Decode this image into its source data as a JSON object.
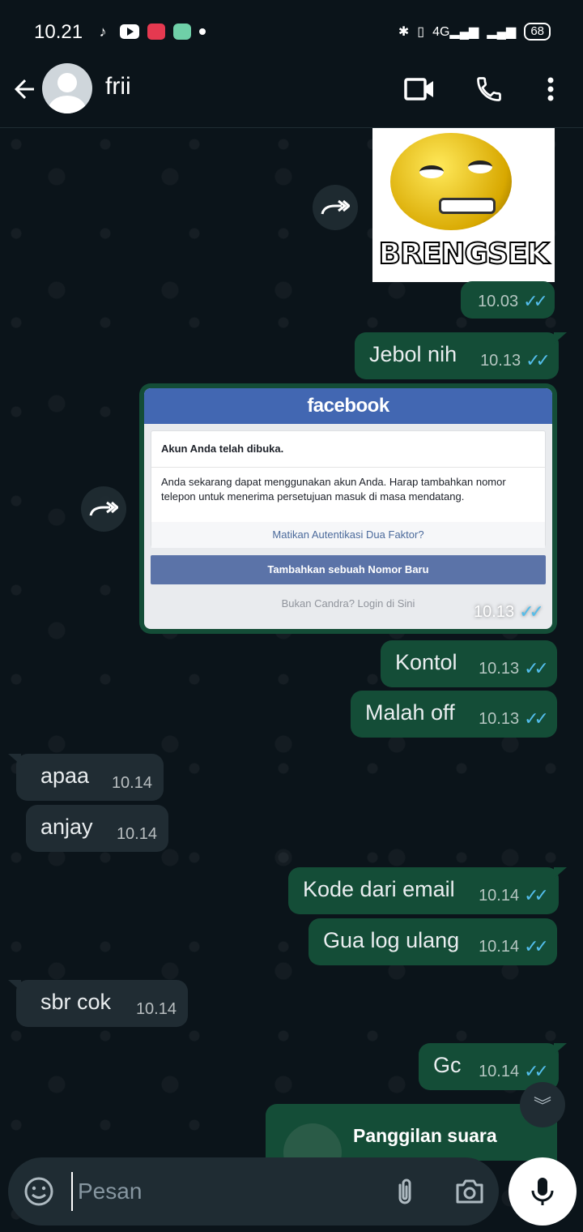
{
  "status_bar": {
    "time": "10.21",
    "signal_label": "4G",
    "battery": "68"
  },
  "header": {
    "contact_name": "frii",
    "icons": [
      "back-arrow-icon",
      "avatar",
      "video-call-icon",
      "phone-icon",
      "more-vert-icon"
    ]
  },
  "sticker": {
    "text": "BRENGSEK",
    "time": "10.03"
  },
  "messages_a": [
    {
      "text": "Jebol nih",
      "time": "10.13",
      "dir": "out"
    }
  ],
  "screenshot_card": {
    "brand": "facebook",
    "title": "Akun Anda telah dibuka.",
    "body": "Anda sekarang dapat menggunakan akun Anda. Harap tambahkan nomor telepon untuk menerima persetujuan masuk di masa mendatang.",
    "link": "Matikan Autentikasi Dua Faktor?",
    "button": "Tambahkan sebuah Nomor Baru",
    "footer": "Bukan Candra? Login di Sini",
    "time": "10.13"
  },
  "messages": [
    {
      "text": "Kontol",
      "time": "10.13",
      "dir": "out"
    },
    {
      "text": "Malah off",
      "time": "10.13",
      "dir": "out"
    },
    {
      "text": "apaa",
      "time": "10.14",
      "dir": "in"
    },
    {
      "text": "anjay",
      "time": "10.14",
      "dir": "in"
    },
    {
      "text": "Kode dari email",
      "time": "10.14",
      "dir": "out"
    },
    {
      "text": "Gua log ulang",
      "time": "10.14",
      "dir": "out"
    },
    {
      "text": "sbr cok",
      "time": "10.14",
      "dir": "in"
    },
    {
      "text": "Gc",
      "time": "10.14",
      "dir": "out"
    }
  ],
  "call_card": {
    "title": "Panggilan suara"
  },
  "composer": {
    "placeholder": "Pesan"
  },
  "colors": {
    "outgoing_bubble": "#144d37",
    "incoming_bubble": "#202c33",
    "read_ticks": "#53bdeb",
    "background": "#0b141a"
  }
}
